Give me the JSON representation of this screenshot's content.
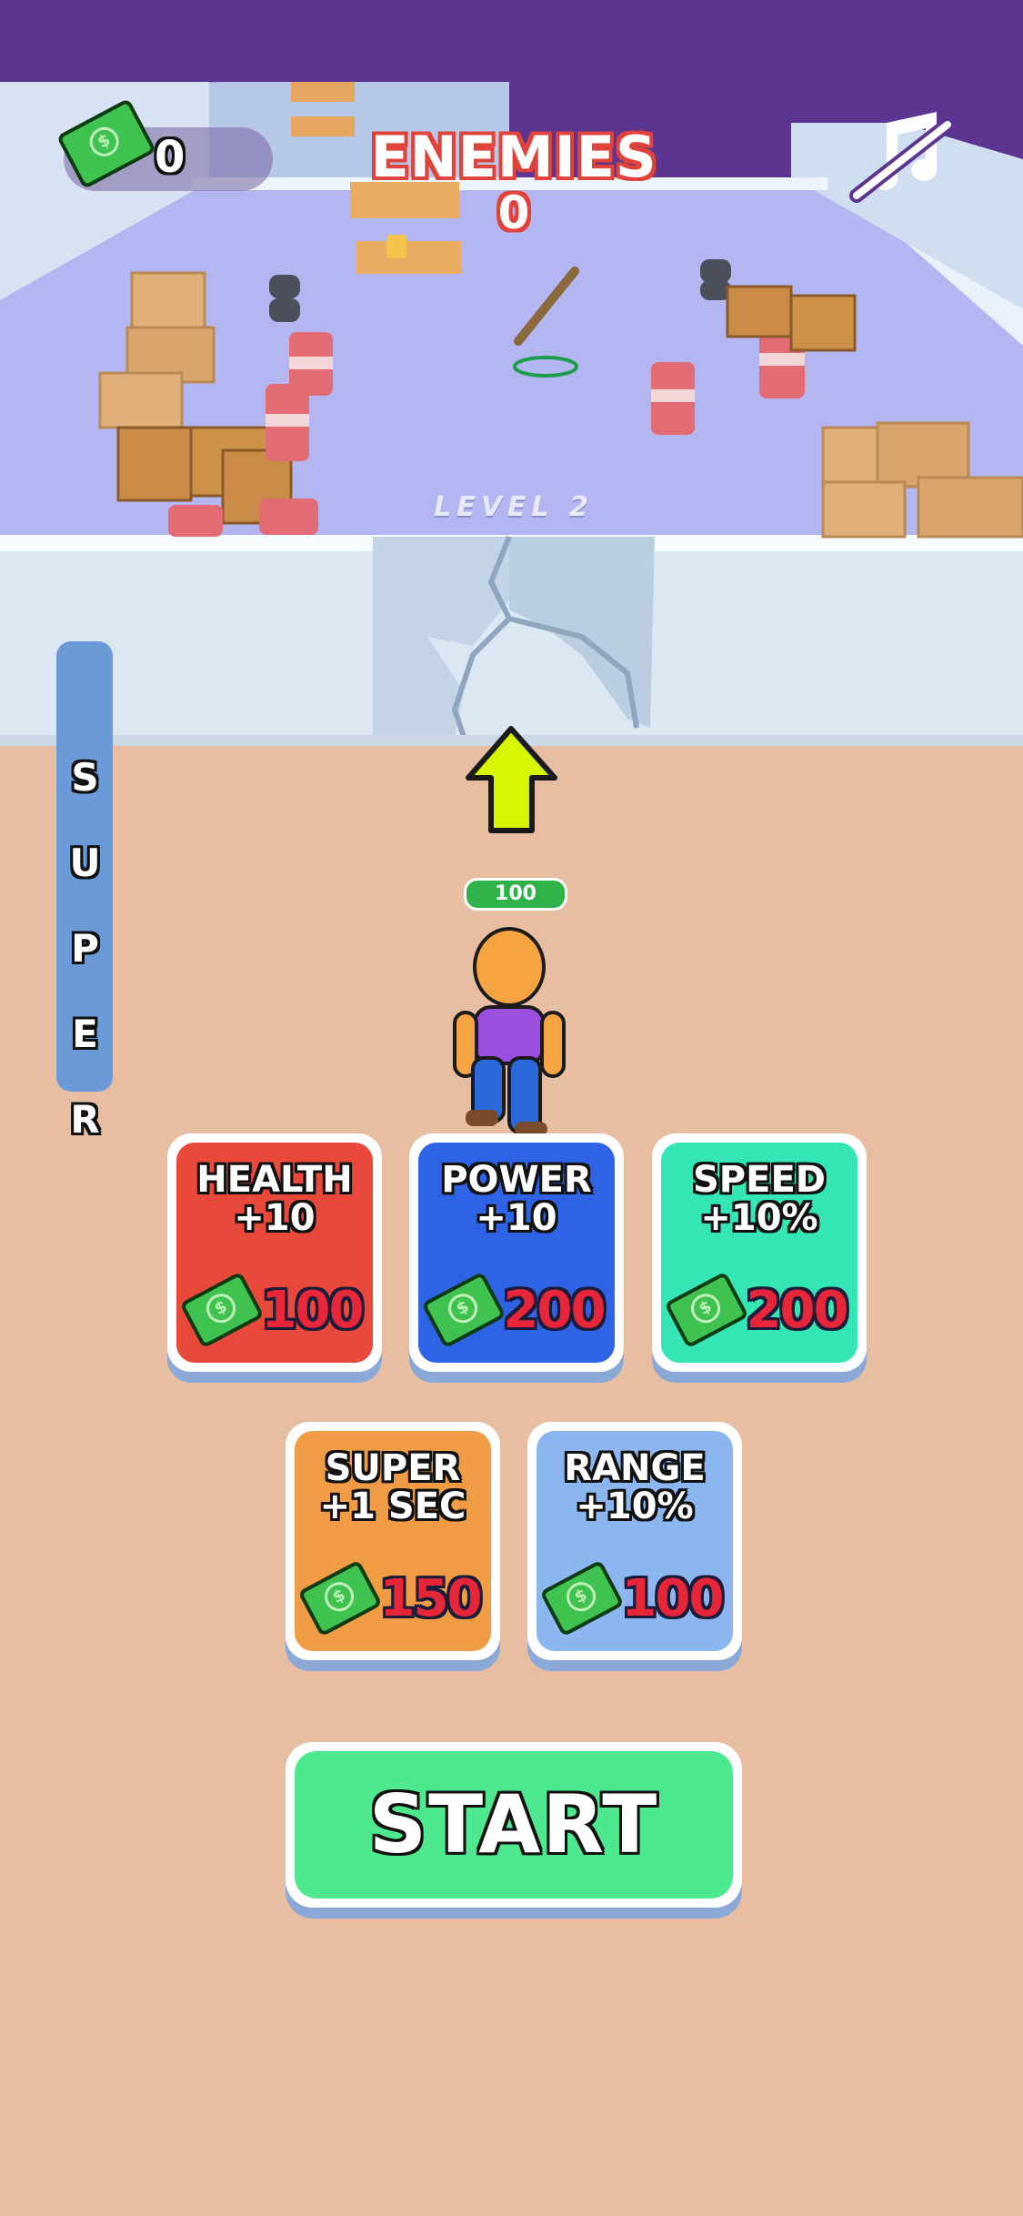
{
  "hud": {
    "cash": "0",
    "enemies_label": "ENEMIES",
    "enemies_count": "0",
    "music_icon": "music-muted-icon"
  },
  "arena": {
    "level_label": "LEVEL 2"
  },
  "super_meter": {
    "label": "S U P E R"
  },
  "player": {
    "health": "100"
  },
  "upgrades": [
    {
      "title_line1": "HEALTH",
      "title_line2": "+10",
      "cost": "100",
      "color": "#e8493a"
    },
    {
      "title_line1": "POWER",
      "title_line2": "+10",
      "cost": "200",
      "color": "#2f63e6"
    },
    {
      "title_line1": "SPEED",
      "title_line2": "+10%",
      "cost": "200",
      "color": "#34e6b4"
    },
    {
      "title_line1": "SUPER",
      "title_line2": "+1 SEC",
      "cost": "150",
      "color": "#ef9c45"
    },
    {
      "title_line1": "RANGE",
      "title_line2": "+10%",
      "cost": "100",
      "color": "#8bb6f0"
    }
  ],
  "start_button": {
    "label": "START",
    "color": "#4ee88f"
  }
}
